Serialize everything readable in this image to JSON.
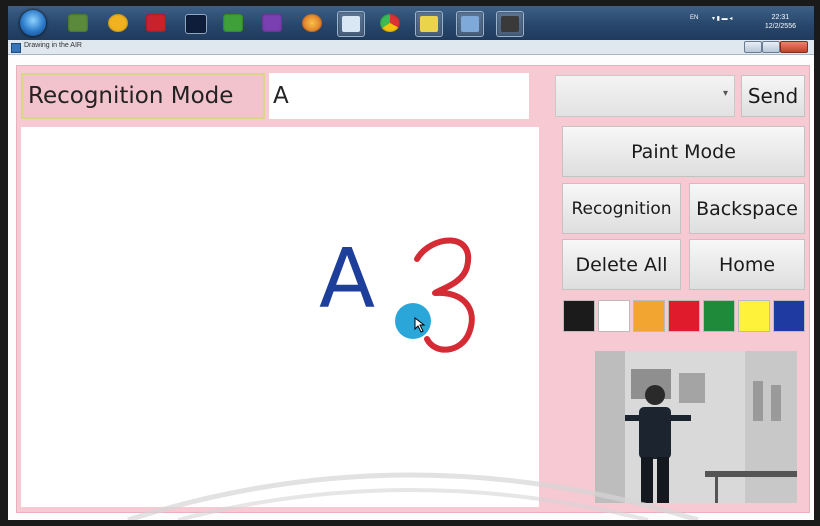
{
  "taskbar": {
    "icons": [
      "windows-start-orb",
      "monitor-icon",
      "orange-triangle-icon",
      "acrobat-icon",
      "visual-studio-icon",
      "csharp-icon",
      "vs-purple-icon",
      "firefox-icon",
      "folder-app-icon",
      "chrome-icon",
      "editor-icon",
      "window-app-icon",
      "drawing-app-icon"
    ],
    "tray_lang": "EN",
    "clock_time": "22:31",
    "clock_date": "12/2/2556"
  },
  "window": {
    "title": "Drawing in the AIR"
  },
  "header": {
    "mode_label": "Recognition Mode",
    "recognized_text": "A",
    "port_select_value": "",
    "send_label": "Send"
  },
  "canvas": {
    "recognized_char": "A",
    "handwritten_stroke": "3"
  },
  "buttons": {
    "paint_mode": "Paint Mode",
    "recognition": "Recognition",
    "backspace": "Backspace",
    "delete_all": "Delete All",
    "home": "Home"
  },
  "colors": {
    "swatches": [
      "#1b1b1b",
      "#ffffff",
      "#f2a531",
      "#e01b2b",
      "#1f8a3a",
      "#fff23a",
      "#1f3aa0"
    ],
    "panel_bg": "#f6c9d3",
    "char_color": "#1d3f9b",
    "stroke_color": "#d42b35",
    "cursor_color": "#1fa2d6"
  }
}
